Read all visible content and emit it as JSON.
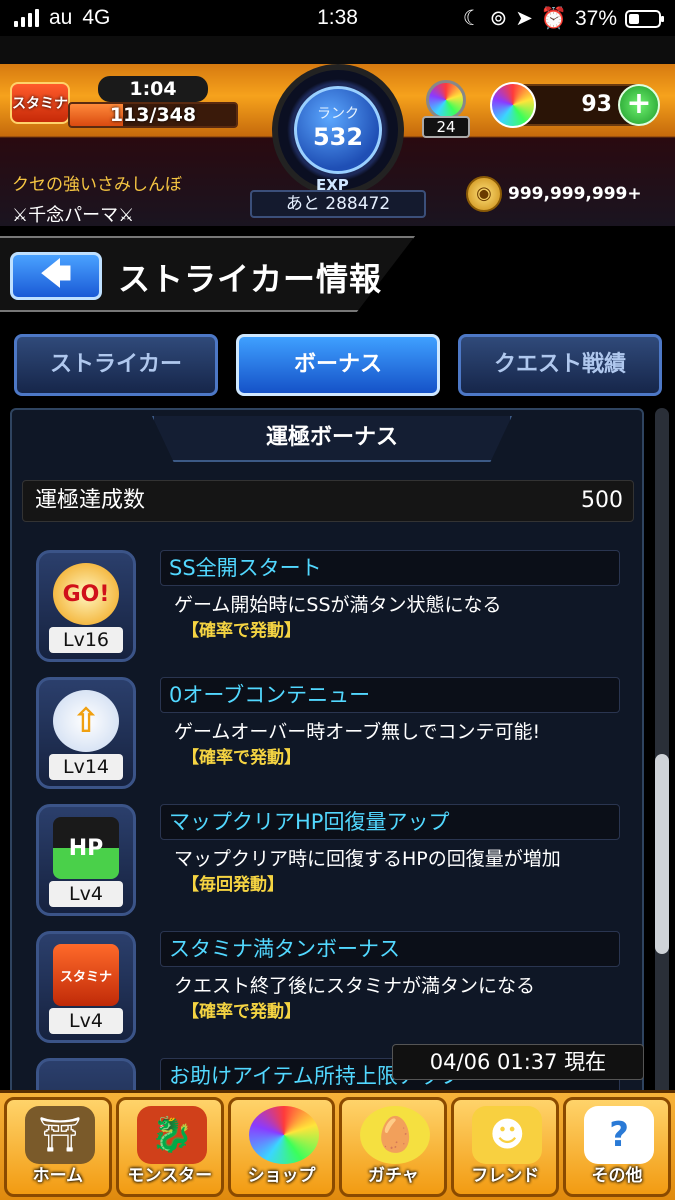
{
  "status_bar": {
    "carrier": "au",
    "network": "4G",
    "time": "1:38",
    "battery": "37%",
    "battery_fraction": 0.37
  },
  "header": {
    "stamina_label": "スタミナ",
    "stamina_timer": "1:04",
    "stamina_value": "113/348",
    "stamina_fraction": 0.32,
    "rank_label": "ランク",
    "rank_value": "532",
    "exp_label": "EXP",
    "exp_remaining": "あと 288472",
    "item_count": "24",
    "orb_count": "93",
    "plus_symbol": "+",
    "player_name": "クセの強いさみしんぼ",
    "player_title": "⚔千念パーマ⚔",
    "gold": "999,999,999+"
  },
  "title_bar": {
    "back_symbol": "🡄",
    "title": "ストライカー情報"
  },
  "tabs": [
    {
      "label": "ストライカー",
      "active": false
    },
    {
      "label": "ボーナス",
      "active": true
    },
    {
      "label": "クエスト戦績",
      "active": false
    }
  ],
  "panel": {
    "title": "運極ボーナス",
    "summary_label": "運極達成数",
    "summary_value": "500",
    "bonuses": [
      {
        "icon": "go-icon",
        "icon_text": "GO!",
        "level": "Lv16",
        "name": "SS全開スタート",
        "desc": "ゲーム開始時にSSが満タン状態になる",
        "cond": "【確率で発動】"
      },
      {
        "icon": "wing-arrow-icon",
        "icon_text": "⇧",
        "level": "Lv14",
        "name": "0オーブコンテニュー",
        "desc": "ゲームオーバー時オーブ無しでコンテ可能!",
        "cond": "【確率で発動】"
      },
      {
        "icon": "hp-arrow-icon",
        "icon_text": "HP",
        "level": "Lv4",
        "name": "マップクリアHP回復量アップ",
        "desc": "マップクリア時に回復するHPの回復量が増加",
        "cond": "【毎回発動】"
      },
      {
        "icon": "stamina-arrow-icon",
        "icon_text": "スタミナ",
        "level": "Lv4",
        "name": "スタミナ満タンボーナス",
        "desc": "クエスト終了後にスタミナが満タンになる",
        "cond": "【確率で発動】"
      },
      {
        "icon": "item-icon",
        "icon_text": "",
        "level": "",
        "name": "お助けアイテム所持上限アップ",
        "desc": "",
        "cond": ""
      }
    ],
    "timestamp": "04/06 01:37 現在"
  },
  "bottom_nav": [
    {
      "label": "ホーム",
      "icon": "home-gate-icon",
      "glyph": "⛩"
    },
    {
      "label": "モンスター",
      "icon": "dragon-icon",
      "glyph": "🐉"
    },
    {
      "label": "ショップ",
      "icon": "orb-icon",
      "glyph": "●"
    },
    {
      "label": "ガチャ",
      "icon": "egg-icon",
      "glyph": "🥚"
    },
    {
      "label": "フレンド",
      "icon": "friends-icon",
      "glyph": "☻"
    },
    {
      "label": "その他",
      "icon": "question-icon",
      "glyph": "?"
    }
  ]
}
